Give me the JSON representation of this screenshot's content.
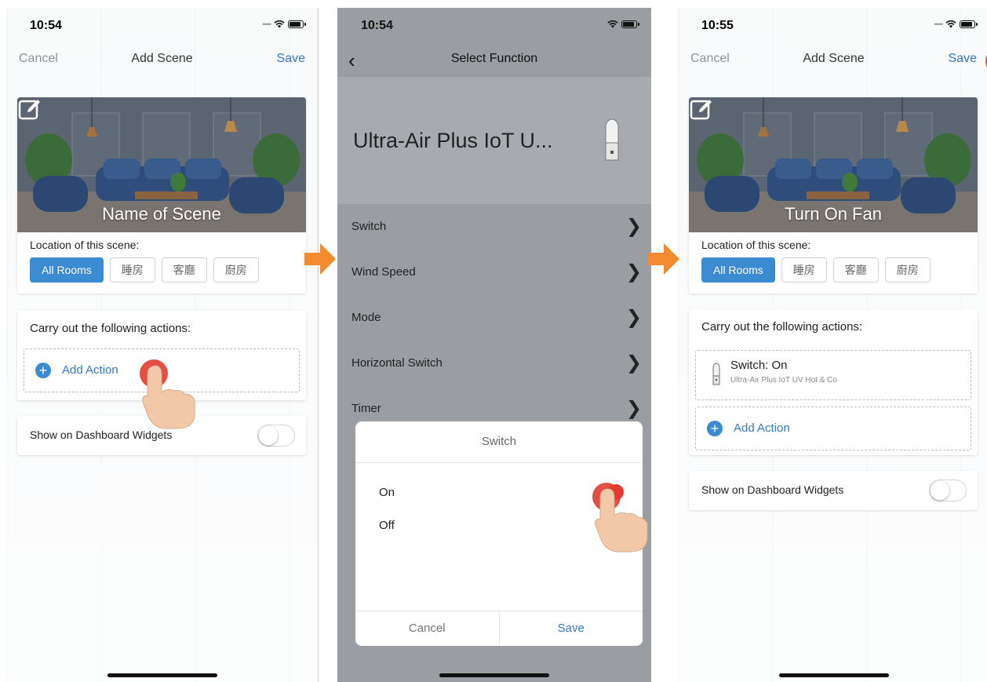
{
  "screens": [
    {
      "time": "10:54",
      "nav": {
        "left": "Cancel",
        "title": "Add Scene",
        "right": "Save"
      },
      "scene_name": "Name of Scene",
      "location_label": "Location of this scene:",
      "rooms": [
        "All Rooms",
        "睡房",
        "客廳",
        "廚房"
      ],
      "actions_title": "Carry out the following actions:",
      "add_action_label": "Add Action",
      "widget_label": "Show on Dashboard Widgets",
      "widget_enabled": false
    },
    {
      "time": "10:54",
      "nav": {
        "title": "Select Function"
      },
      "device_name": "Ultra-Air Plus IoT U...",
      "functions": [
        "Switch",
        "Wind Speed",
        "Mode",
        "Horizontal Switch",
        "Timer"
      ],
      "dialog": {
        "title": "Switch",
        "options": [
          "On",
          "Off"
        ],
        "selected": "On",
        "cancel": "Cancel",
        "save": "Save"
      }
    },
    {
      "time": "10:55",
      "nav": {
        "left": "Cancel",
        "title": "Add Scene",
        "right": "Save"
      },
      "scene_name": "Turn On Fan",
      "location_label": "Location of this scene:",
      "rooms": [
        "All Rooms",
        "睡房",
        "客廳",
        "廚房"
      ],
      "actions_title": "Carry out the following actions:",
      "action_item": {
        "title": "Switch: On",
        "subtitle": "Ultra-Air Plus IoT UV Hot & Co"
      },
      "add_action_label": "Add Action",
      "widget_label": "Show on Dashboard Widgets",
      "widget_enabled": false
    }
  ],
  "colors": {
    "accent": "#3b8bd0",
    "link": "#3478c6",
    "selected_radio": "#e23b2e",
    "arrow": "#f28a30"
  }
}
